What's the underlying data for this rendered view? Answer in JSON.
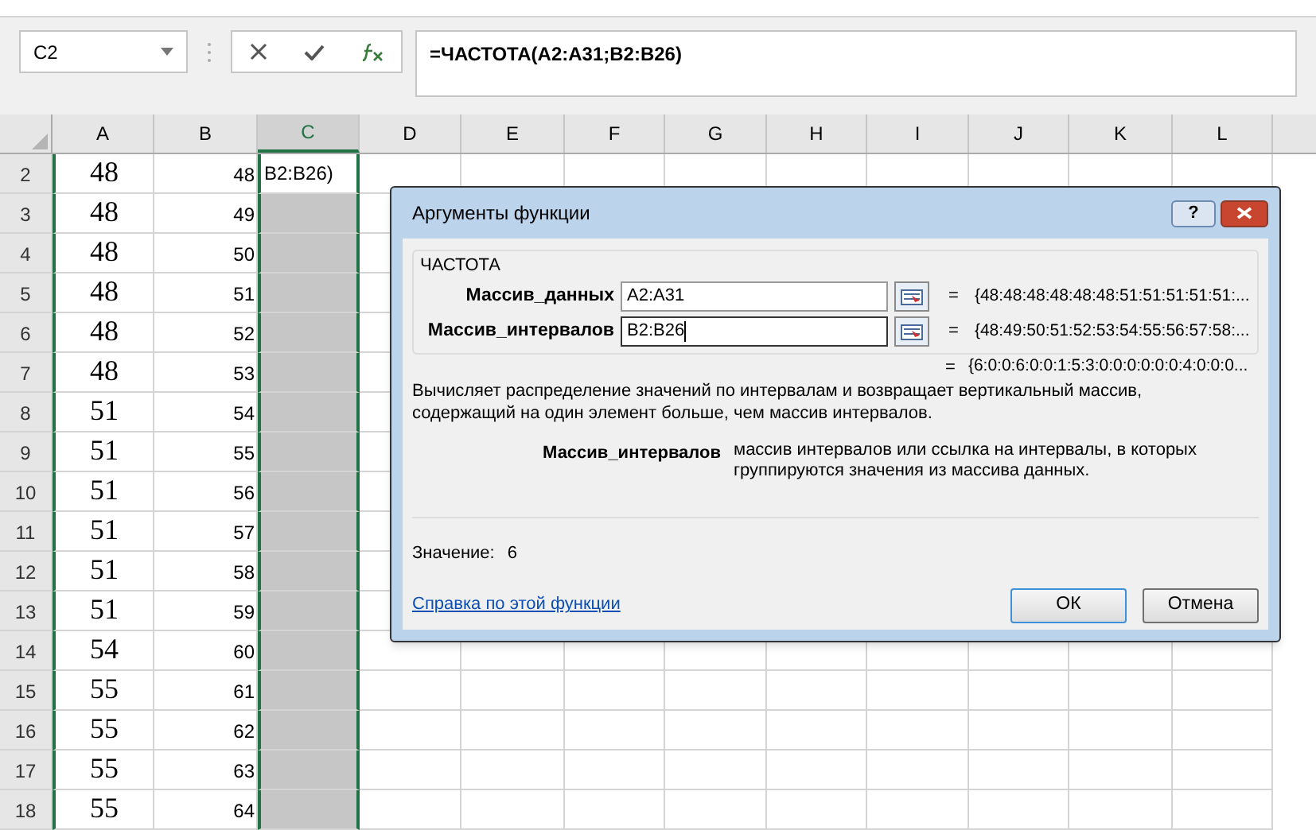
{
  "formula_bar": {
    "name_box": "C2",
    "formula": "=ЧАСТОТА(A2:A31;B2:B26)"
  },
  "columns": [
    {
      "label": "A",
      "selected": false
    },
    {
      "label": "B",
      "selected": false
    },
    {
      "label": "C",
      "selected": true
    },
    {
      "label": "D",
      "selected": false
    },
    {
      "label": "E",
      "selected": false
    },
    {
      "label": "F",
      "selected": false
    },
    {
      "label": "G",
      "selected": false
    },
    {
      "label": "H",
      "selected": false
    },
    {
      "label": "I",
      "selected": false
    },
    {
      "label": "J",
      "selected": false
    },
    {
      "label": "K",
      "selected": false
    },
    {
      "label": "L",
      "selected": false
    }
  ],
  "rows": [
    {
      "num": "2",
      "a": "48",
      "b": "48",
      "c": "B2:B26)",
      "shaded": false
    },
    {
      "num": "3",
      "a": "48",
      "b": "49",
      "shaded": true
    },
    {
      "num": "4",
      "a": "48",
      "b": "50",
      "shaded": true
    },
    {
      "num": "5",
      "a": "48",
      "b": "51",
      "shaded": true
    },
    {
      "num": "6",
      "a": "48",
      "b": "52",
      "shaded": true
    },
    {
      "num": "7",
      "a": "48",
      "b": "53",
      "shaded": true
    },
    {
      "num": "8",
      "a": "51",
      "b": "54",
      "shaded": true
    },
    {
      "num": "9",
      "a": "51",
      "b": "55",
      "shaded": true
    },
    {
      "num": "10",
      "a": "51",
      "b": "56",
      "shaded": true
    },
    {
      "num": "11",
      "a": "51",
      "b": "57",
      "shaded": true
    },
    {
      "num": "12",
      "a": "51",
      "b": "58",
      "shaded": true
    },
    {
      "num": "13",
      "a": "51",
      "b": "59",
      "shaded": true
    },
    {
      "num": "14",
      "a": "54",
      "b": "60",
      "shaded": true
    },
    {
      "num": "15",
      "a": "55",
      "b": "61",
      "shaded": true
    },
    {
      "num": "16",
      "a": "55",
      "b": "62",
      "shaded": true
    },
    {
      "num": "17",
      "a": "55",
      "b": "63",
      "shaded": true
    },
    {
      "num": "18",
      "a": "55",
      "b": "64",
      "shaded": true
    }
  ],
  "dialog": {
    "title": "Аргументы функции",
    "help": "?",
    "function_name": "ЧАСТОТА",
    "arguments": [
      {
        "label": "Массив_данных",
        "value": "A2:A31",
        "equals": "=",
        "result": "{48:48:48:48:48:48:51:51:51:51:51:...",
        "focused": false
      },
      {
        "label": "Массив_интервалов",
        "value": "B2:B26",
        "equals": "=",
        "result": "{48:49:50:51:52:53:54:55:56:57:58:...",
        "focused": true
      }
    ],
    "total_equals": "=",
    "total_result": "{6:0:0:6:0:0:1:5:3:0:0:0:0:0:0:4:0:0:0...",
    "description": "Вычисляет распределение значений по интервалам и возвращает вертикальный массив, содержащий на один элемент больше, чем массив интервалов.",
    "param_name": "Массив_интервалов",
    "param_description": "массив интервалов или ссылка на интервалы, в которых группируются значения из массива данных.",
    "value_label": "Значение:",
    "value": "6",
    "help_link": "Справка по этой функции",
    "buttons": [
      {
        "label": "ОК",
        "default": true
      },
      {
        "label": "Отмена",
        "default": false
      }
    ]
  }
}
